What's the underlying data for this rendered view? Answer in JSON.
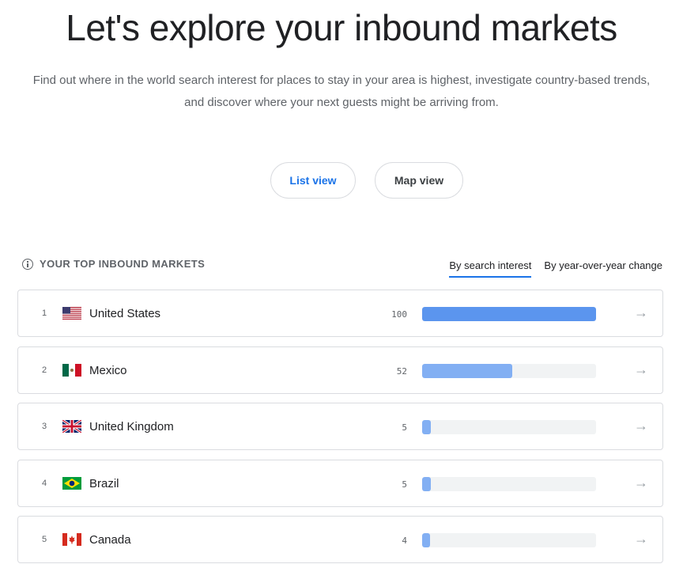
{
  "hero": {
    "title": "Let's explore your inbound markets",
    "subtitle_line1": "Find out where in the world search interest for places to stay in your area is highest, investigate country-based trends,",
    "subtitle_line2": "and discover where your next guests might be arriving from."
  },
  "views": {
    "list_label": "List view",
    "map_label": "Map view",
    "selected": "List view"
  },
  "section": {
    "title": "YOUR TOP INBOUND MARKETS",
    "info_icon": "info-circle-icon",
    "sort_tabs": [
      "By search interest",
      "By year-over-year change"
    ],
    "active_sort": "By search interest"
  },
  "colors": {
    "accent": "#1a73e8",
    "bar_full": "#5b95ee",
    "bar_partial": "#82aff3",
    "track": "#f1f3f4"
  },
  "markets": [
    {
      "rank": "1",
      "country": "United States",
      "value": "100",
      "fraction": 1.0,
      "flag_icon": "us-flag-icon"
    },
    {
      "rank": "2",
      "country": "Mexico",
      "value": "52",
      "fraction": 0.52,
      "flag_icon": "mexico-flag-icon"
    },
    {
      "rank": "3",
      "country": "United Kingdom",
      "value": "5",
      "fraction": 0.05,
      "flag_icon": "uk-flag-icon"
    },
    {
      "rank": "4",
      "country": "Brazil",
      "value": "5",
      "fraction": 0.05,
      "flag_icon": "brazil-flag-icon"
    },
    {
      "rank": "5",
      "country": "Canada",
      "value": "4",
      "fraction": 0.04,
      "flag_icon": "canada-flag-icon"
    }
  ],
  "row_action_icon": "arrow-right-icon"
}
